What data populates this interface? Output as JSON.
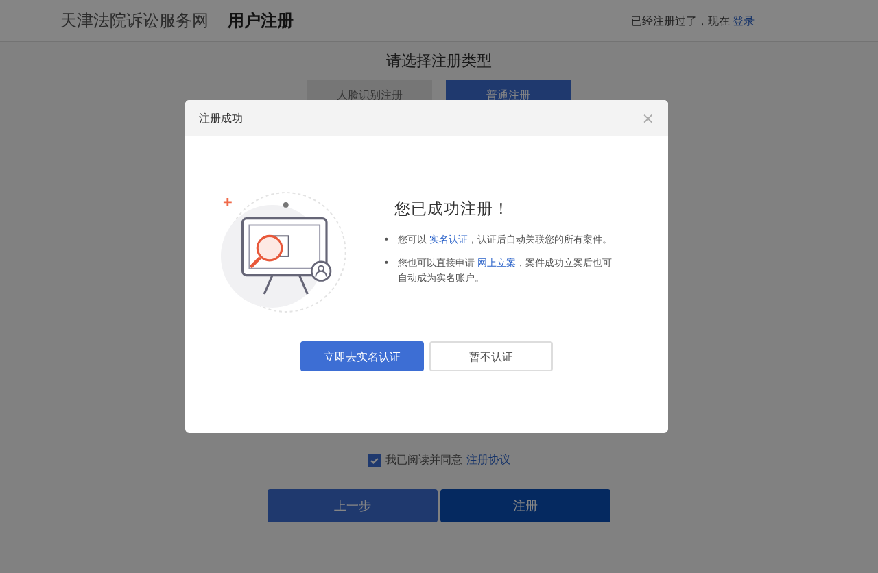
{
  "header": {
    "site_name": "天津法院诉讼服务网",
    "page_title": "用户注册",
    "login_prompt": "已经注册过了，现在",
    "login_link": "登录"
  },
  "register_type": {
    "title": "请选择注册类型",
    "tabs": [
      {
        "label": "人脸识别注册",
        "selected": false
      },
      {
        "label": "普通注册",
        "selected": true
      }
    ]
  },
  "agreement": {
    "checked": true,
    "text": "我已阅读并同意",
    "link": "注册协议"
  },
  "buttons": [
    {
      "label": "上一步",
      "kind": "secondary"
    },
    {
      "label": "注册",
      "kind": "primary"
    }
  ],
  "dialog": {
    "title": "注册成功",
    "close": "×",
    "heading": "您已成功注册！",
    "bullets": [
      {
        "marker": "•",
        "before": "您可以 ",
        "link": "实名认证",
        "after": "，认证后自动关联您的所有案件。"
      },
      {
        "marker": "•",
        "before": "您也可以直接申请 ",
        "link": "网上立案",
        "after": "，案件成功立案后也可自动成为实名账户。"
      }
    ],
    "buttons": [
      {
        "label": "立即去实名认证",
        "kind": "primary"
      },
      {
        "label": "暂不认证",
        "kind": "secondary"
      }
    ]
  }
}
